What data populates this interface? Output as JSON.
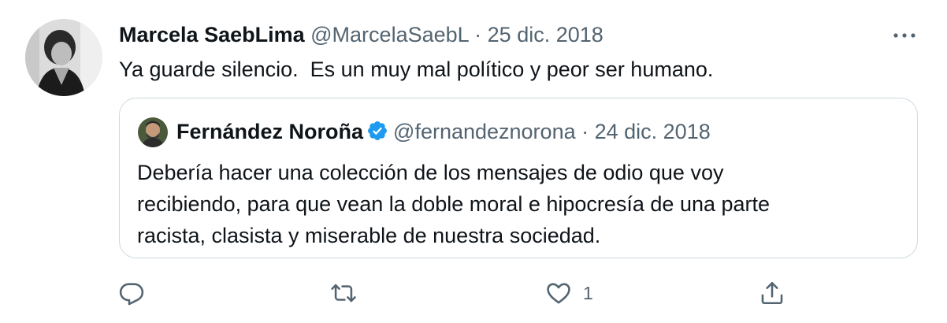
{
  "tweet": {
    "author_name": "Marcela SaebLima",
    "author_handle": "@MarcelaSaebL",
    "separator": " · ",
    "date": "25 dic. 2018",
    "text": "Ya guarde silencio.  Es un muy mal político y peor ser humano."
  },
  "quote": {
    "author_name": "Fernández Noroña",
    "author_handle": "@fernandeznorona",
    "separator": " · ",
    "date": "24 dic. 2018",
    "text_lines": [
      "Debería hacer una colección de los mensajes de odio que voy",
      "recibiendo, para que vean la doble moral e hipocresía de una parte",
      "racista, clasista y miserable de nuestra sociedad."
    ]
  },
  "actions": {
    "reply_icon": "reply-icon",
    "retweet_icon": "retweet-icon",
    "like_icon": "heart-icon",
    "like_count": "1",
    "share_icon": "share-icon"
  },
  "colors": {
    "text": "#0f1419",
    "muted": "#536471",
    "border": "#cfd9de",
    "verified": "#1d9bf0"
  }
}
